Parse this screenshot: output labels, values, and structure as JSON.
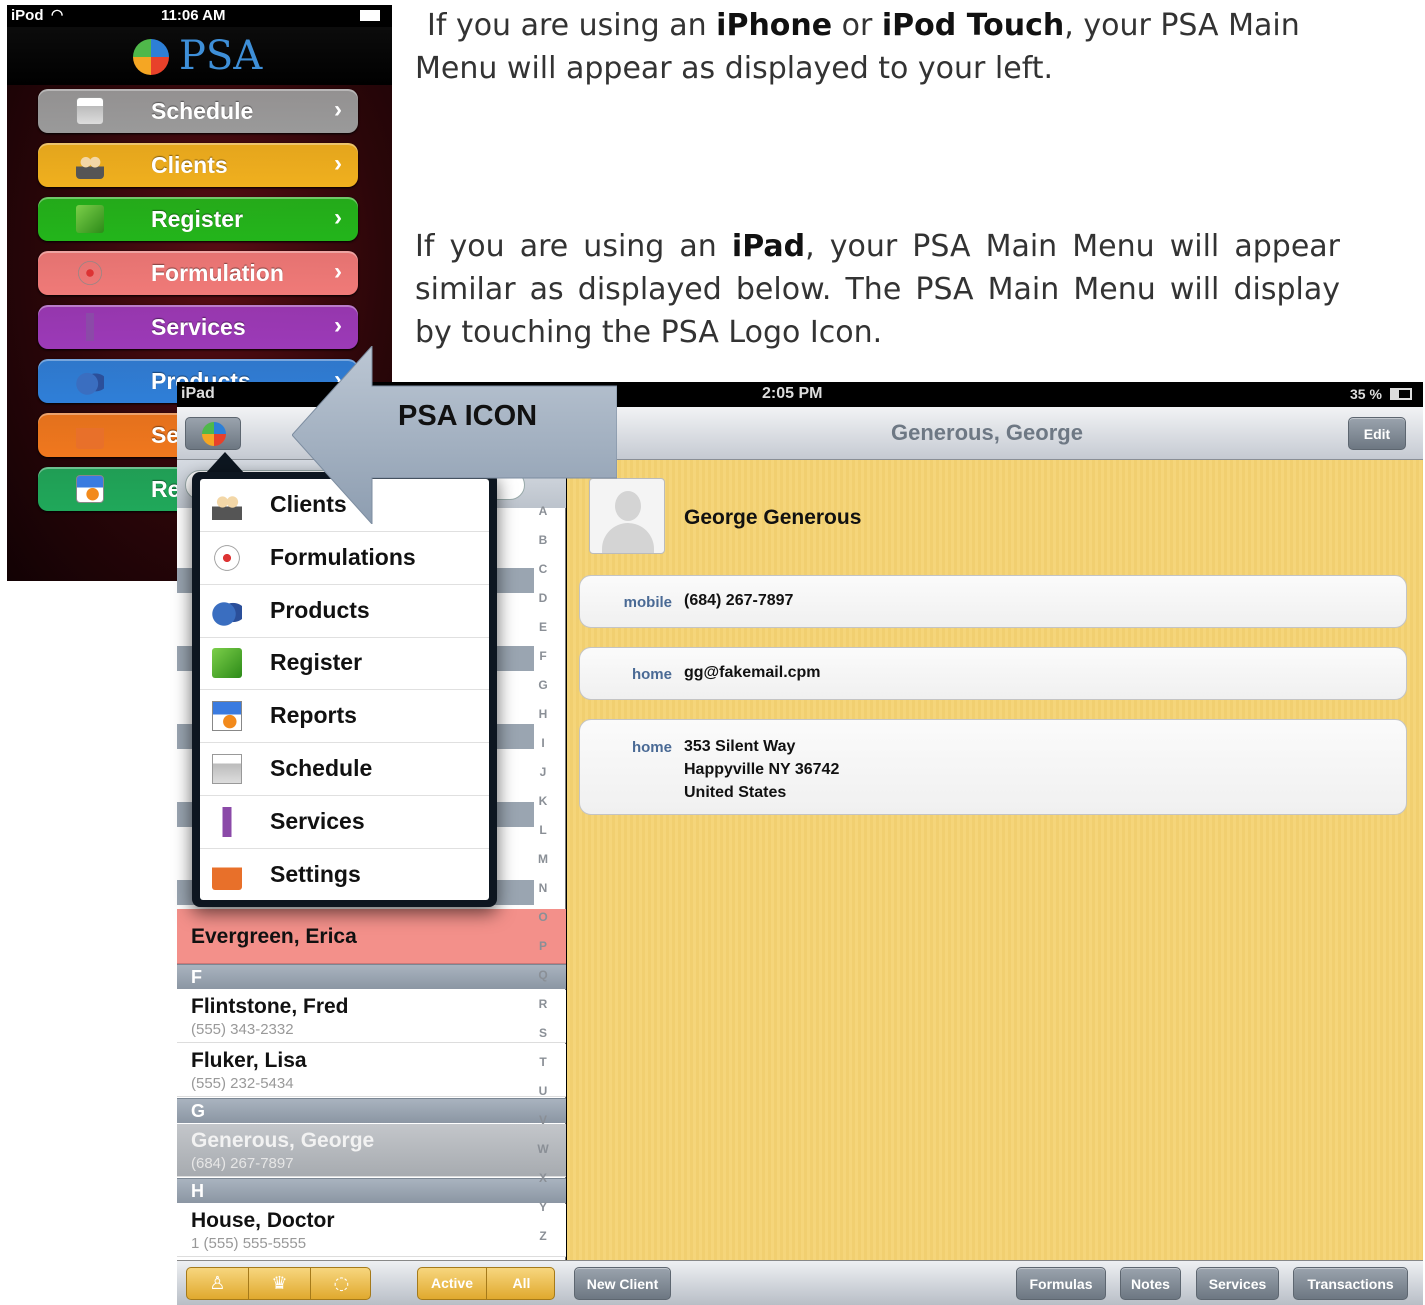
{
  "doc": {
    "para1": {
      "t1": "If you are using an ",
      "b1": "iPhone",
      "t2": " or ",
      "b2": "iPod Touch",
      "t3": ", your PSA Main Menu will appear as displayed to your left."
    },
    "para2": {
      "t1": "If you are using an ",
      "b1": "iPad",
      "t2": ", your PSA Main Menu will appear similar as displayed below.  The PSA Main Menu will display by touching the PSA  Logo Icon."
    }
  },
  "ipod": {
    "carrier": "iPod",
    "time": "11:06 AM",
    "logo_text": "PSA",
    "menu": [
      {
        "label": "Schedule",
        "color": "#9a9a9a",
        "icon": "calendar-icon"
      },
      {
        "label": "Clients",
        "color": "#f0b01e",
        "icon": "people-icon"
      },
      {
        "label": "Register",
        "color": "#23b51b",
        "icon": "register-icon"
      },
      {
        "label": "Formulation",
        "color": "#f07a78",
        "icon": "atom-icon"
      },
      {
        "label": "Services",
        "color": "#9c3ab8",
        "icon": "scissors-icon"
      },
      {
        "label": "Products",
        "color": "#2f7fd8",
        "icon": "bottles-icon"
      },
      {
        "label": "Settings",
        "color": "#f0781e",
        "icon": "toolbox-icon"
      },
      {
        "label": "Reports",
        "color": "#20a85a",
        "icon": "report-icon"
      }
    ]
  },
  "callout": {
    "label": "PSA ICON"
  },
  "ipad": {
    "carrier": "iPad",
    "time": "2:05 PM",
    "battery": "35 %",
    "nav_title": "Generous, George",
    "edit_label": "Edit",
    "popover_items": [
      {
        "label": "Clients",
        "icon": "people-icon"
      },
      {
        "label": "Formulations",
        "icon": "atom-icon"
      },
      {
        "label": "Products",
        "icon": "bottles-icon"
      },
      {
        "label": "Register",
        "icon": "register-icon"
      },
      {
        "label": "Reports",
        "icon": "report-icon"
      },
      {
        "label": "Schedule",
        "icon": "calendar-icon"
      },
      {
        "label": "Services",
        "icon": "scissors-icon"
      },
      {
        "label": "Settings",
        "icon": "toolbox-icon"
      }
    ],
    "list": {
      "highlight": "Evergreen, Erica",
      "sections": [
        {
          "letter": "F",
          "clients": [
            {
              "name": "Flintstone, Fred",
              "phone": "(555) 343-2332"
            },
            {
              "name": "Fluker, Lisa",
              "phone": "(555) 232-5434"
            }
          ]
        },
        {
          "letter": "G",
          "clients": [
            {
              "name": "Generous, George",
              "phone": "(684) 267-7897"
            }
          ]
        },
        {
          "letter": "H",
          "clients": [
            {
              "name": "House, Doctor",
              "phone": "1 (555) 555-5555"
            }
          ]
        }
      ],
      "index": [
        "A",
        "B",
        "C",
        "D",
        "E",
        "F",
        "G",
        "H",
        "I",
        "J",
        "K",
        "L",
        "M",
        "N",
        "O",
        "P",
        "Q",
        "R",
        "S",
        "T",
        "U",
        "V",
        "W",
        "X",
        "Y",
        "Z"
      ]
    },
    "detail": {
      "name": "George Generous",
      "mobile_label": "mobile",
      "mobile": "(684) 267-7897",
      "email_label": "home",
      "email": "gg@fakemail.cpm",
      "address_label": "home",
      "address_line1": "353 Silent Way",
      "address_line2": "Happyville NY 36742",
      "address_line3": "United States"
    },
    "bottom": {
      "filter_active": "Active",
      "filter_all": "All",
      "new_client": "New Client",
      "formulas": "Formulas",
      "notes": "Notes",
      "services": "Services",
      "transactions": "Transactions"
    }
  }
}
